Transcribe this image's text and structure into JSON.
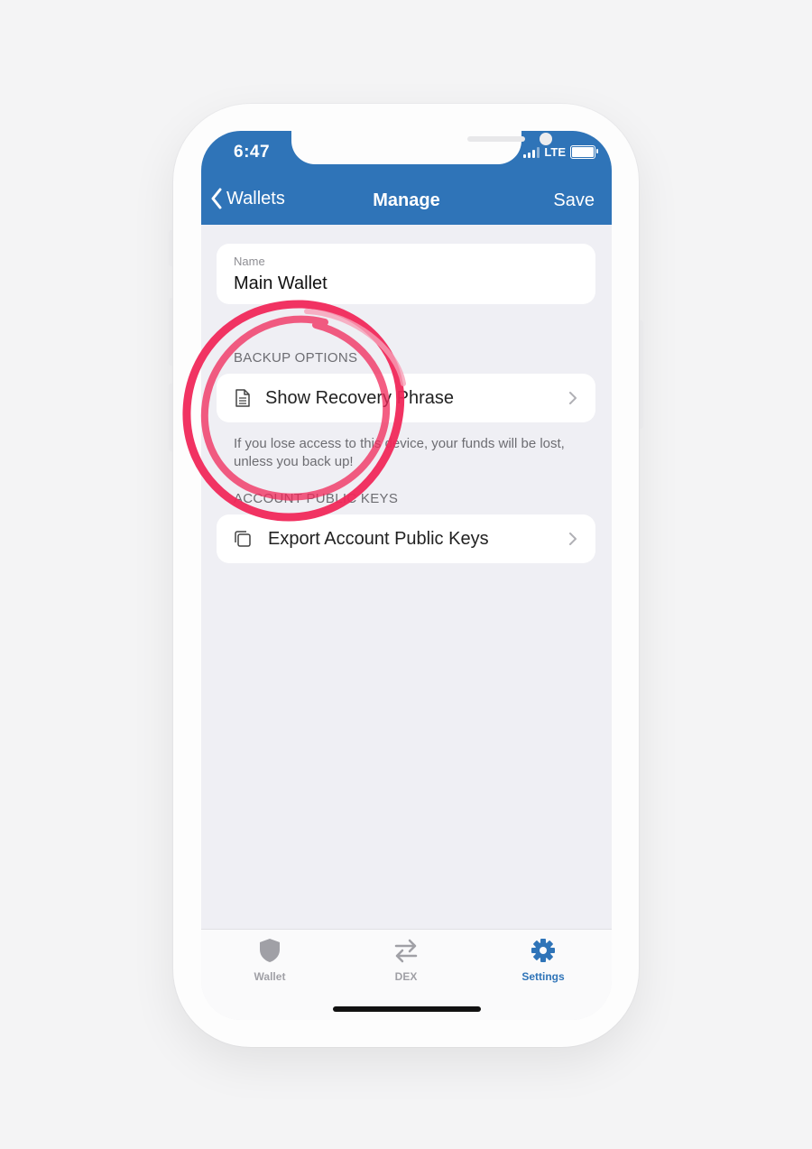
{
  "status_bar": {
    "time": "6:47",
    "network": "LTE"
  },
  "navbar": {
    "back_label": "Wallets",
    "title": "Manage",
    "save_label": "Save"
  },
  "name_field": {
    "label": "Name",
    "value": "Main Wallet"
  },
  "backup_section": {
    "header": "BACKUP OPTIONS",
    "item_label": "Show Recovery Phrase",
    "item_icon": "document-icon",
    "footnote": "If you lose access to this device, your funds will be lost, unless you back up!"
  },
  "keys_section": {
    "header": "ACCOUNT PUBLIC KEYS",
    "item_label": "Export Account Public Keys",
    "item_icon": "copy-icon"
  },
  "tabs": [
    {
      "label": "Wallet",
      "icon": "shield-icon",
      "active": false
    },
    {
      "label": "DEX",
      "icon": "swap-arrows-icon",
      "active": false
    },
    {
      "label": "Settings",
      "icon": "gear-icon",
      "active": true
    }
  ],
  "colors": {
    "brand_blue": "#2f74b8",
    "annotation_red": "#f0285a",
    "inactive_tab": "#a0a0a6"
  }
}
